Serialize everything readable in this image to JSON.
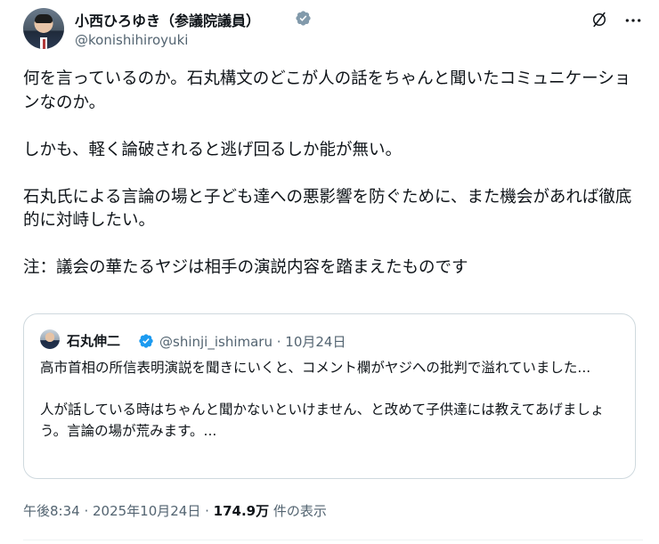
{
  "author": {
    "display_name": "小西ひろゆき（参議院議員）",
    "handle": "@konishihiroyuki"
  },
  "post": {
    "paragraphs": [
      "何を言っているのか。石丸構文のどこが人の話をちゃんと聞いたコミュニケーションなのか。",
      "しかも、軽く論破されると逃げ回るしか能が無い。",
      "石丸氏による言論の場と子ども達への悪影響を防ぐために、また機会があれば徹底的に対峙したい。",
      "注：議会の華たるヤジは相手の演説内容を踏まえたものです"
    ]
  },
  "quote": {
    "name": "石丸伸二",
    "meta": "@shinji_ishimaru · 10月24日",
    "paragraphs": [
      "高市首相の所信表明演説を聞きにいくと、コメント欄がヤジへの批判で溢れていました...",
      "人が話している時はちゃんと聞かないといけません、と改めて子供達には教えてあげましょう。言論の場が荒みます。..."
    ]
  },
  "footer": {
    "timestamp": "午後8:34 · 2025年10月24日 · ",
    "views_count": "174.9万",
    "views_label": " 件の表示"
  },
  "colors": {
    "verified": "#1d9bf0",
    "text": "#0f1419",
    "secondary": "#536471",
    "border": "#cfd9de"
  },
  "icons": [
    "verified-badge-icon",
    "grok-icon",
    "more-icon"
  ]
}
